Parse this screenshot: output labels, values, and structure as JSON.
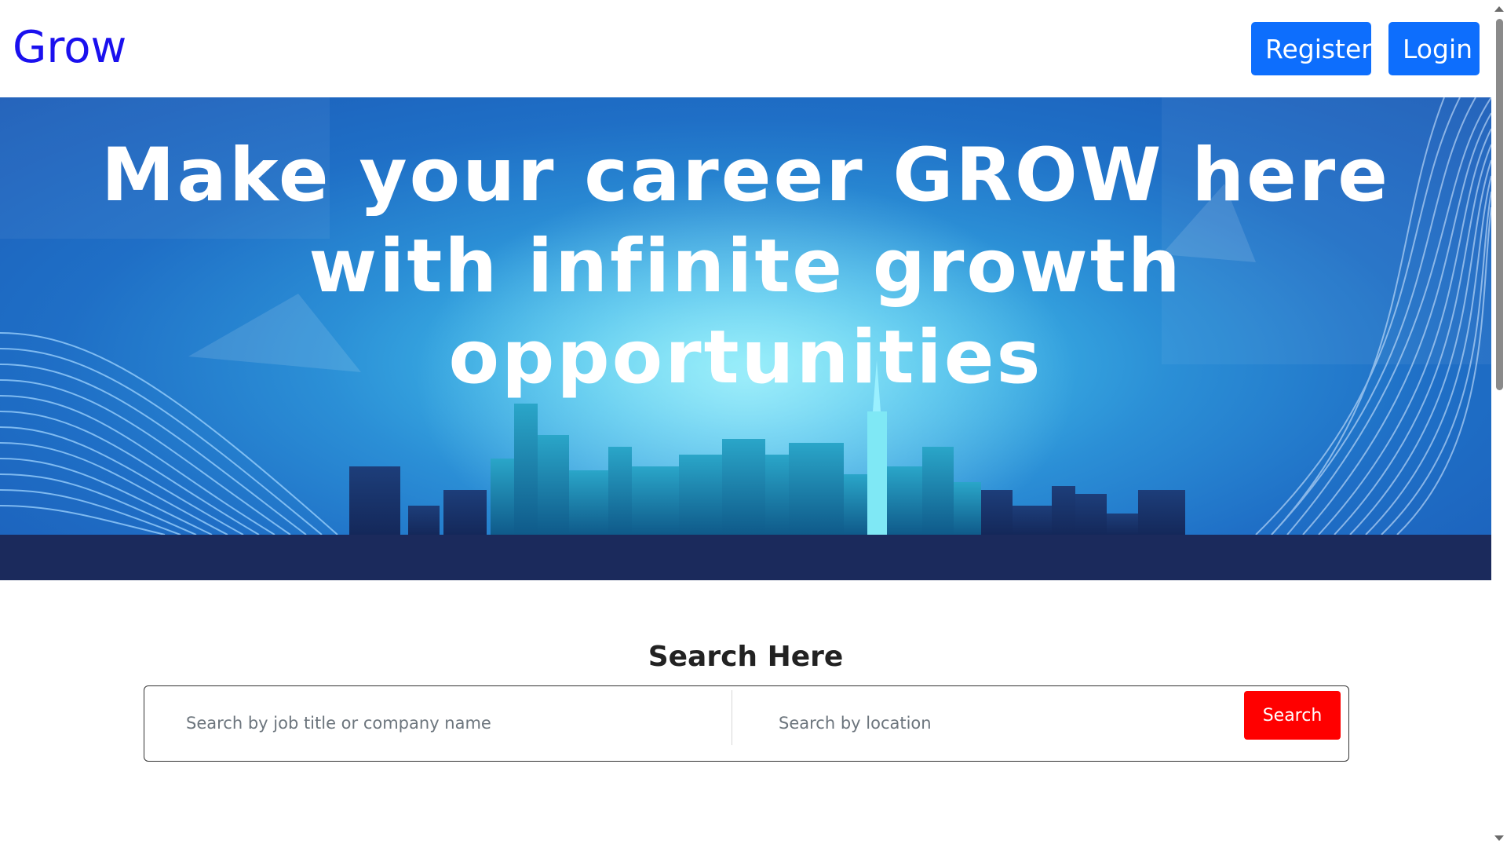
{
  "navbar": {
    "brand": "Grow",
    "register_label": "Register",
    "login_label": "Login"
  },
  "hero": {
    "title": "Make your career GROW here with infinite growth opportunities"
  },
  "search": {
    "heading": "Search Here",
    "title_placeholder": "Search by job title or company name",
    "location_placeholder": "Search by location",
    "button_label": "Search"
  },
  "colors": {
    "brand": "#1a10ee",
    "primary_button": "#0d6efd",
    "search_button": "#ff0000",
    "hero_ground": "#1b2a5c"
  },
  "icons": {
    "scroll_up": "chevron-up-icon",
    "scroll_down": "chevron-down-icon"
  }
}
